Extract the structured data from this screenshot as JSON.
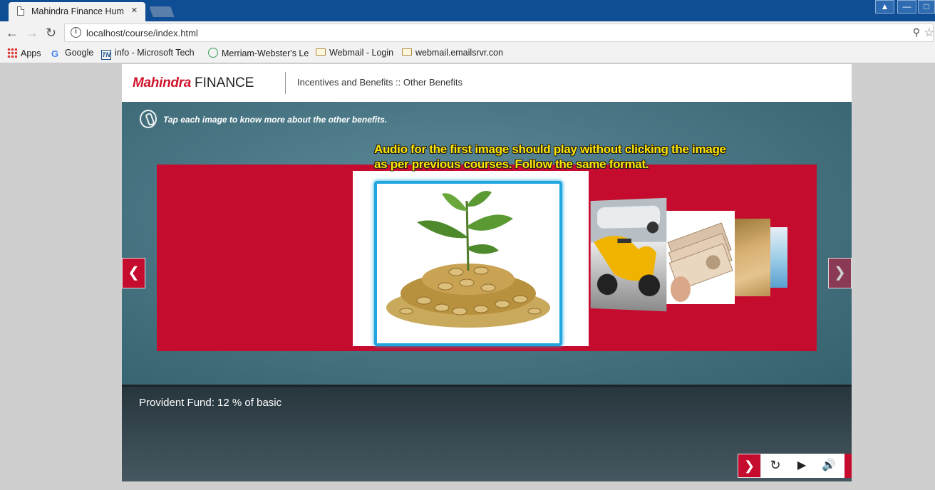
{
  "browser": {
    "tab_title": "Mahindra Finance Huma",
    "tab_close": "×",
    "url": "localhost/course/index.html",
    "bookmarks": [
      {
        "label": "Apps",
        "icon": "apps-icon"
      },
      {
        "label": "Google",
        "icon": "google-icon"
      },
      {
        "label": "info - Microsoft Tech",
        "icon": "tn-icon"
      },
      {
        "label": "Merriam-Webster's Le",
        "icon": "globe-icon"
      },
      {
        "label": "Webmail - Login",
        "icon": "mail-icon"
      },
      {
        "label": "webmail.emailsrvr.con",
        "icon": "mail-icon"
      }
    ]
  },
  "course": {
    "logo_brand": "Mahindra",
    "logo_suffix": "FINANCE",
    "breadcrumb": "Incentives and Benefits :: Other Benefits",
    "instruction": "Tap each image to know more about the other benefits.",
    "annotation": "Audio for the first image should play without clicking the image as per previous courses. Follow the same format.",
    "caption": "Provident Fund: 12 % of basic"
  },
  "colors": {
    "brand_red": "#c50c2e",
    "selection_blue": "#22a6e0",
    "annotation_yellow": "#ffe600"
  }
}
